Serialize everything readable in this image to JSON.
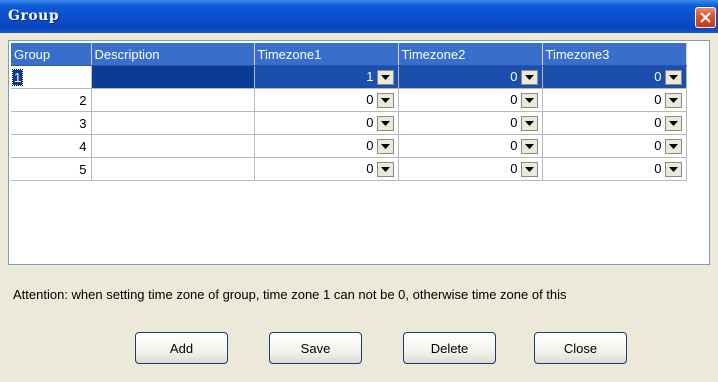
{
  "window": {
    "title": "Group"
  },
  "grid": {
    "columns": [
      "Group",
      "Description",
      "Timezone1",
      "Timezone2",
      "Timezone3"
    ],
    "rows": [
      {
        "group": "1",
        "description": "",
        "tz1": "1",
        "tz2": "0",
        "tz3": "0"
      },
      {
        "group": "2",
        "description": "",
        "tz1": "0",
        "tz2": "0",
        "tz3": "0"
      },
      {
        "group": "3",
        "description": "",
        "tz1": "0",
        "tz2": "0",
        "tz3": "0"
      },
      {
        "group": "4",
        "description": "",
        "tz1": "0",
        "tz2": "0",
        "tz3": "0"
      },
      {
        "group": "5",
        "description": "",
        "tz1": "0",
        "tz2": "0",
        "tz3": "0"
      }
    ]
  },
  "attention": "Attention: when setting time zone of group, time zone 1 can not be 0, otherwise time zone of this",
  "buttons": {
    "add": "Add",
    "save": "Save",
    "delete": "Delete",
    "close": "Close"
  },
  "colors": {
    "title_bar": "#0b4cc8",
    "header": "#3a6ecc",
    "selection": "#0a3c96",
    "close_button": "#d9502c"
  }
}
